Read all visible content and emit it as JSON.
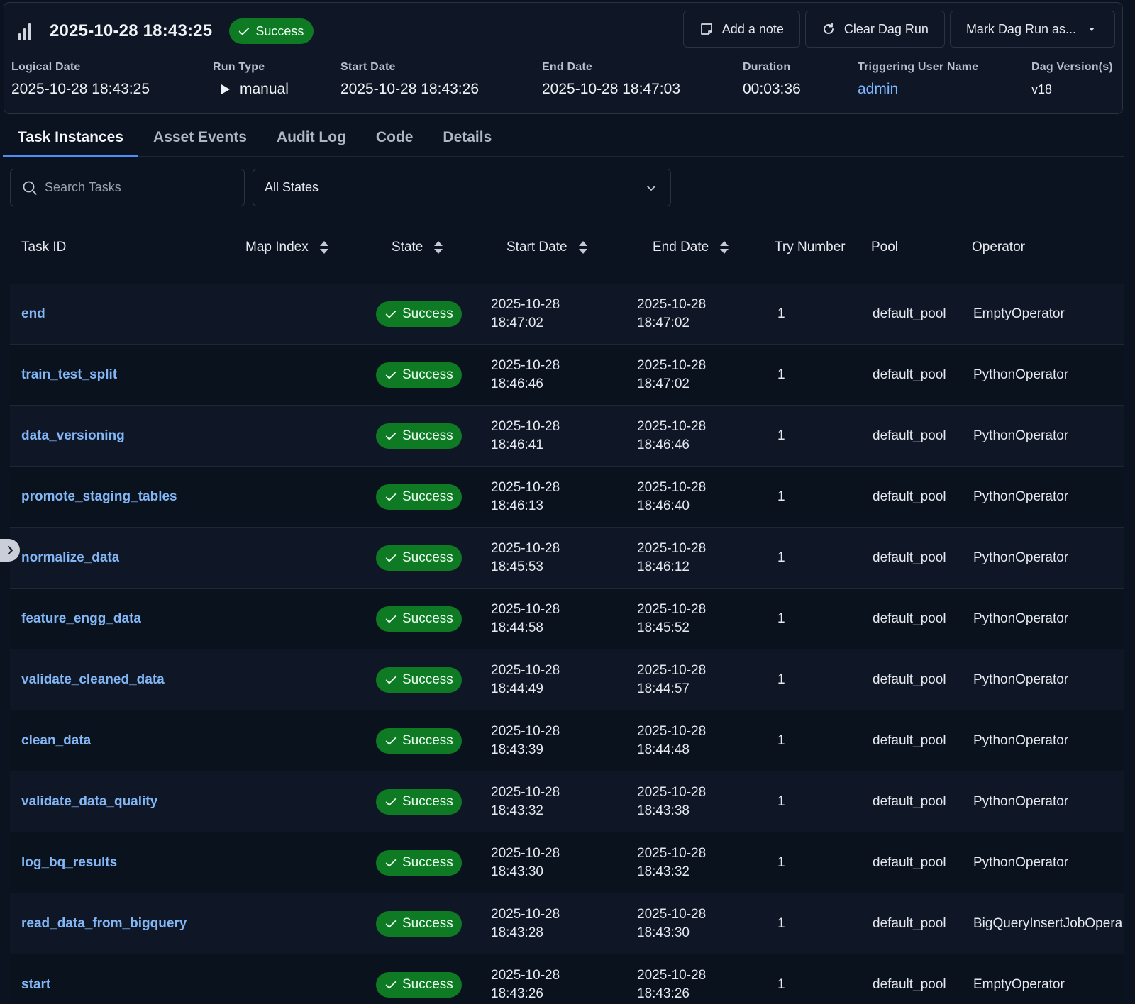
{
  "header": {
    "run_title": "2025-10-28 18:43:25",
    "status": "Success",
    "actions": {
      "add_note": "Add a note",
      "clear_run": "Clear Dag Run",
      "mark_run": "Mark Dag Run as..."
    },
    "meta": {
      "logical_date_label": "Logical Date",
      "logical_date": "2025-10-28 18:43:25",
      "run_type_label": "Run Type",
      "run_type": "manual",
      "start_date_label": "Start Date",
      "start_date": "2025-10-28 18:43:26",
      "end_date_label": "End Date",
      "end_date": "2025-10-28 18:47:03",
      "duration_label": "Duration",
      "duration": "00:03:36",
      "user_label": "Triggering User Name",
      "user": "admin",
      "version_label": "Dag Version(s)",
      "version": "v18"
    }
  },
  "tabs": [
    "Task Instances",
    "Asset Events",
    "Audit Log",
    "Code",
    "Details"
  ],
  "filters": {
    "search_placeholder": "Search Tasks",
    "state_selected": "All States"
  },
  "table": {
    "columns": [
      "Task ID",
      "Map Index",
      "State",
      "Start Date",
      "End Date",
      "Try Number",
      "Pool",
      "Operator"
    ],
    "rows": [
      {
        "task": "end",
        "state": "Success",
        "start_d": "2025-10-28",
        "start_t": "18:47:02",
        "end_d": "2025-10-28",
        "end_t": "18:47:02",
        "try": "1",
        "pool": "default_pool",
        "op": "EmptyOperator"
      },
      {
        "task": "train_test_split",
        "state": "Success",
        "start_d": "2025-10-28",
        "start_t": "18:46:46",
        "end_d": "2025-10-28",
        "end_t": "18:47:02",
        "try": "1",
        "pool": "default_pool",
        "op": "PythonOperator"
      },
      {
        "task": "data_versioning",
        "state": "Success",
        "start_d": "2025-10-28",
        "start_t": "18:46:41",
        "end_d": "2025-10-28",
        "end_t": "18:46:46",
        "try": "1",
        "pool": "default_pool",
        "op": "PythonOperator"
      },
      {
        "task": "promote_staging_tables",
        "state": "Success",
        "start_d": "2025-10-28",
        "start_t": "18:46:13",
        "end_d": "2025-10-28",
        "end_t": "18:46:40",
        "try": "1",
        "pool": "default_pool",
        "op": "PythonOperator"
      },
      {
        "task": "normalize_data",
        "state": "Success",
        "start_d": "2025-10-28",
        "start_t": "18:45:53",
        "end_d": "2025-10-28",
        "end_t": "18:46:12",
        "try": "1",
        "pool": "default_pool",
        "op": "PythonOperator"
      },
      {
        "task": "feature_engg_data",
        "state": "Success",
        "start_d": "2025-10-28",
        "start_t": "18:44:58",
        "end_d": "2025-10-28",
        "end_t": "18:45:52",
        "try": "1",
        "pool": "default_pool",
        "op": "PythonOperator"
      },
      {
        "task": "validate_cleaned_data",
        "state": "Success",
        "start_d": "2025-10-28",
        "start_t": "18:44:49",
        "end_d": "2025-10-28",
        "end_t": "18:44:57",
        "try": "1",
        "pool": "default_pool",
        "op": "PythonOperator"
      },
      {
        "task": "clean_data",
        "state": "Success",
        "start_d": "2025-10-28",
        "start_t": "18:43:39",
        "end_d": "2025-10-28",
        "end_t": "18:44:48",
        "try": "1",
        "pool": "default_pool",
        "op": "PythonOperator"
      },
      {
        "task": "validate_data_quality",
        "state": "Success",
        "start_d": "2025-10-28",
        "start_t": "18:43:32",
        "end_d": "2025-10-28",
        "end_t": "18:43:38",
        "try": "1",
        "pool": "default_pool",
        "op": "PythonOperator"
      },
      {
        "task": "log_bq_results",
        "state": "Success",
        "start_d": "2025-10-28",
        "start_t": "18:43:30",
        "end_d": "2025-10-28",
        "end_t": "18:43:32",
        "try": "1",
        "pool": "default_pool",
        "op": "PythonOperator"
      },
      {
        "task": "read_data_from_bigquery",
        "state": "Success",
        "start_d": "2025-10-28",
        "start_t": "18:43:28",
        "end_d": "2025-10-28",
        "end_t": "18:43:30",
        "try": "1",
        "pool": "default_pool",
        "op": "BigQueryInsertJobOpera"
      },
      {
        "task": "start",
        "state": "Success",
        "start_d": "2025-10-28",
        "start_t": "18:43:26",
        "end_d": "2025-10-28",
        "end_t": "18:43:26",
        "try": "1",
        "pool": "default_pool",
        "op": "EmptyOperator"
      }
    ]
  },
  "colors": {
    "background": "#0b1320",
    "success": "#0e7a23",
    "link": "#82b6f5",
    "tab_indicator": "#4e8df5"
  },
  "icons": {
    "run": "bar-chart-icon",
    "note": "note-icon",
    "clear": "refresh-icon",
    "dropdown": "caret-down-icon",
    "search": "search-icon",
    "sort": "sort-icon",
    "check": "check-icon",
    "play": "play-icon",
    "sidebar": "chevron-right-icon"
  }
}
